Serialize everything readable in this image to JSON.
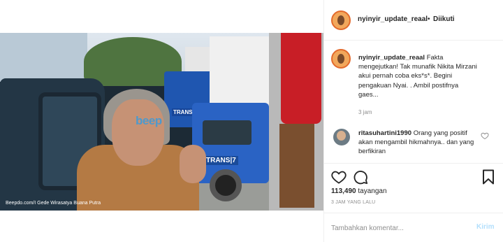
{
  "video": {
    "watermark": "beep",
    "brand_text": "TRANS|7",
    "credit": "Beepdo.com/I Gede Wirasatya Buana Putra"
  },
  "header": {
    "username": "nyinyir_update_reaal",
    "separator": "•",
    "follow_status": "Diikuti"
  },
  "caption": {
    "username": "nyinyir_update_reaal",
    "text": "Fakta mengejutkan! Tak munafik Nikita Mirzani akui pernah coba eks*s*. Begini pengakuan Nyai. . Ambil postifnya gaes...",
    "time": "3 jam"
  },
  "comments": [
    {
      "username": "ritasuhartini1990",
      "text": "Orang yang positif akan mengambil hikmahnya.. dan yang berfikiran"
    }
  ],
  "actions": {
    "views_count": "113,490",
    "views_label": "tayangan",
    "posted_time": "3 JAM YANG LALU"
  },
  "add_comment": {
    "placeholder": "Tambahkan komentar...",
    "post_label": "Kirim"
  },
  "colors": {
    "link_blue_disabled": "#b2dffc",
    "secondary_text": "#8e8e8e",
    "border": "#efefef"
  }
}
